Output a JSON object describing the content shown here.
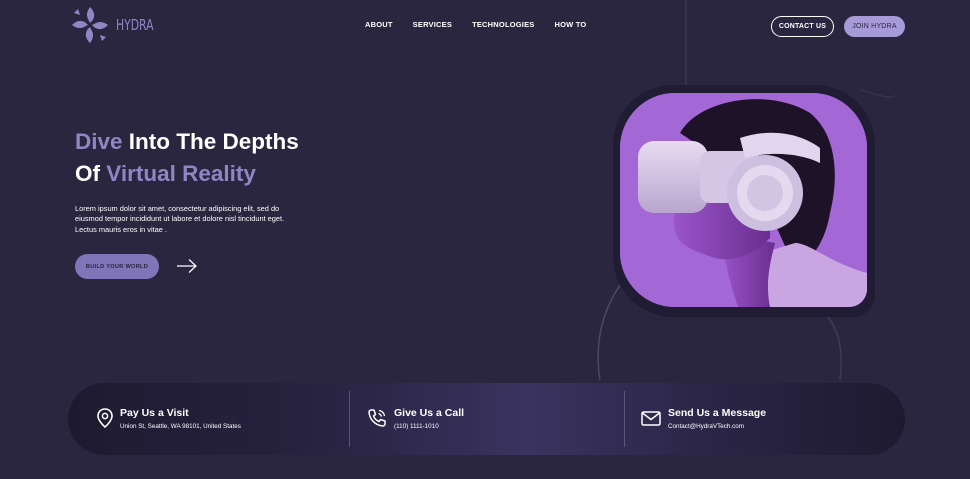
{
  "brand": {
    "name": "HYDRA"
  },
  "nav": {
    "items": [
      "ABOUT",
      "SERVICES",
      "TECHNOLOGIES",
      "HOW TO"
    ]
  },
  "header": {
    "contact_label": "CONTACT US",
    "join_label": "JOIN HYDRA"
  },
  "hero": {
    "title_line1_accent": "Dive",
    "title_line1_rest": " Into The Depths",
    "title_line2_start": "Of ",
    "title_line2_accent": "Virtual Reality",
    "description": "Lorem ipsum dolor sit amet, consectetur adipiscing elit, sed do eiusmod tempor incididunt ut labore et dolore nisl tincidunt eget. Lectus mauris eros in vitae .",
    "cta_label": "BUILD YOUR WORLD",
    "arrow_icon": "arrow-right-icon"
  },
  "info": {
    "items": [
      {
        "icon": "location-pin-icon",
        "title": "Pay Us a Visit",
        "text": "Union St, Seattle, WA 98101, United States"
      },
      {
        "icon": "phone-icon",
        "title": "Give Us a Call",
        "text": "(110) 1111-1010"
      },
      {
        "icon": "envelope-icon",
        "title": "Send Us a Message",
        "text": "Contact@HydraVTech.com"
      }
    ]
  },
  "colors": {
    "background": "#2a2640",
    "accent": "#8f86c4",
    "button": "#a69ad8",
    "image_bg": "#a467d6"
  }
}
